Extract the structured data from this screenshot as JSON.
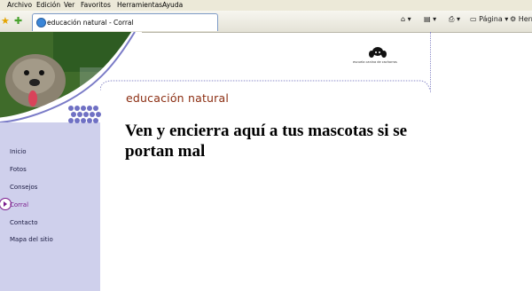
{
  "browser": {
    "menu": [
      "Archivo",
      "Edición",
      "Ver",
      "Favoritos",
      "Herramientas",
      "Ayuda"
    ],
    "tab_title": "educación natural - Corral",
    "page_button": "Página",
    "tools_button": "Herr"
  },
  "site": {
    "logo_text": "escuela canina de cachorros",
    "section_title": "educación natural",
    "headline": "Ven y encierra aquí a tus mascotas si se portan mal"
  },
  "nav": {
    "items": [
      "Inicio",
      "Fotos",
      "Consejos",
      "Corral",
      "Contacto",
      "Mapa del sitio"
    ],
    "active": "Corral"
  },
  "colors": {
    "sidebar": "#cfd0ec",
    "accent": "#7a1c8c",
    "title": "#8b2d11"
  }
}
